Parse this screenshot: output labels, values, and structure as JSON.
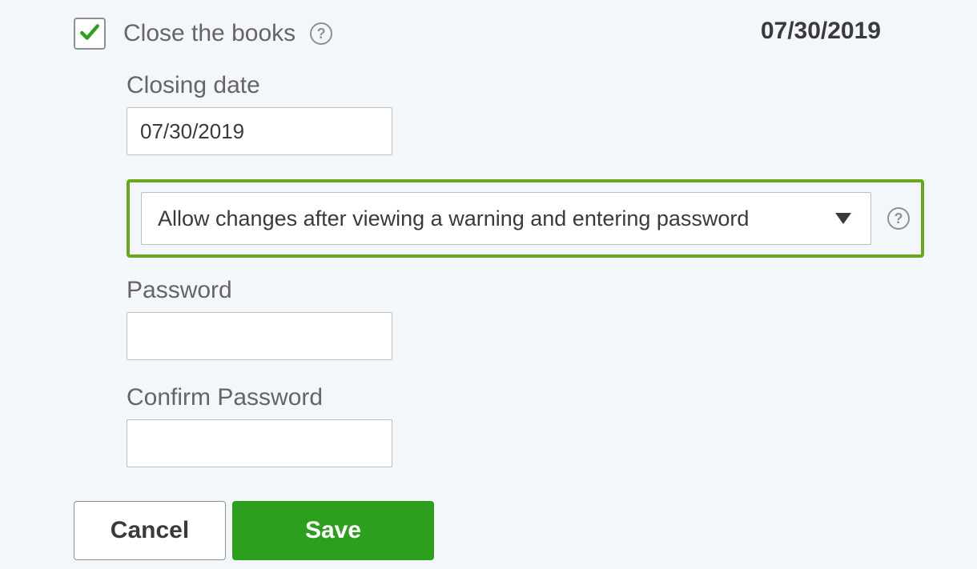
{
  "header": {
    "checkbox_label": "Close the books",
    "checkbox_checked": true,
    "date_display": "07/30/2019"
  },
  "closing_date": {
    "label": "Closing date",
    "value": "07/30/2019"
  },
  "restriction_select": {
    "value": "Allow changes after viewing a warning and entering password"
  },
  "password": {
    "label": "Password",
    "value": ""
  },
  "confirm_password": {
    "label": "Confirm Password",
    "value": ""
  },
  "buttons": {
    "cancel": "Cancel",
    "save": "Save"
  }
}
